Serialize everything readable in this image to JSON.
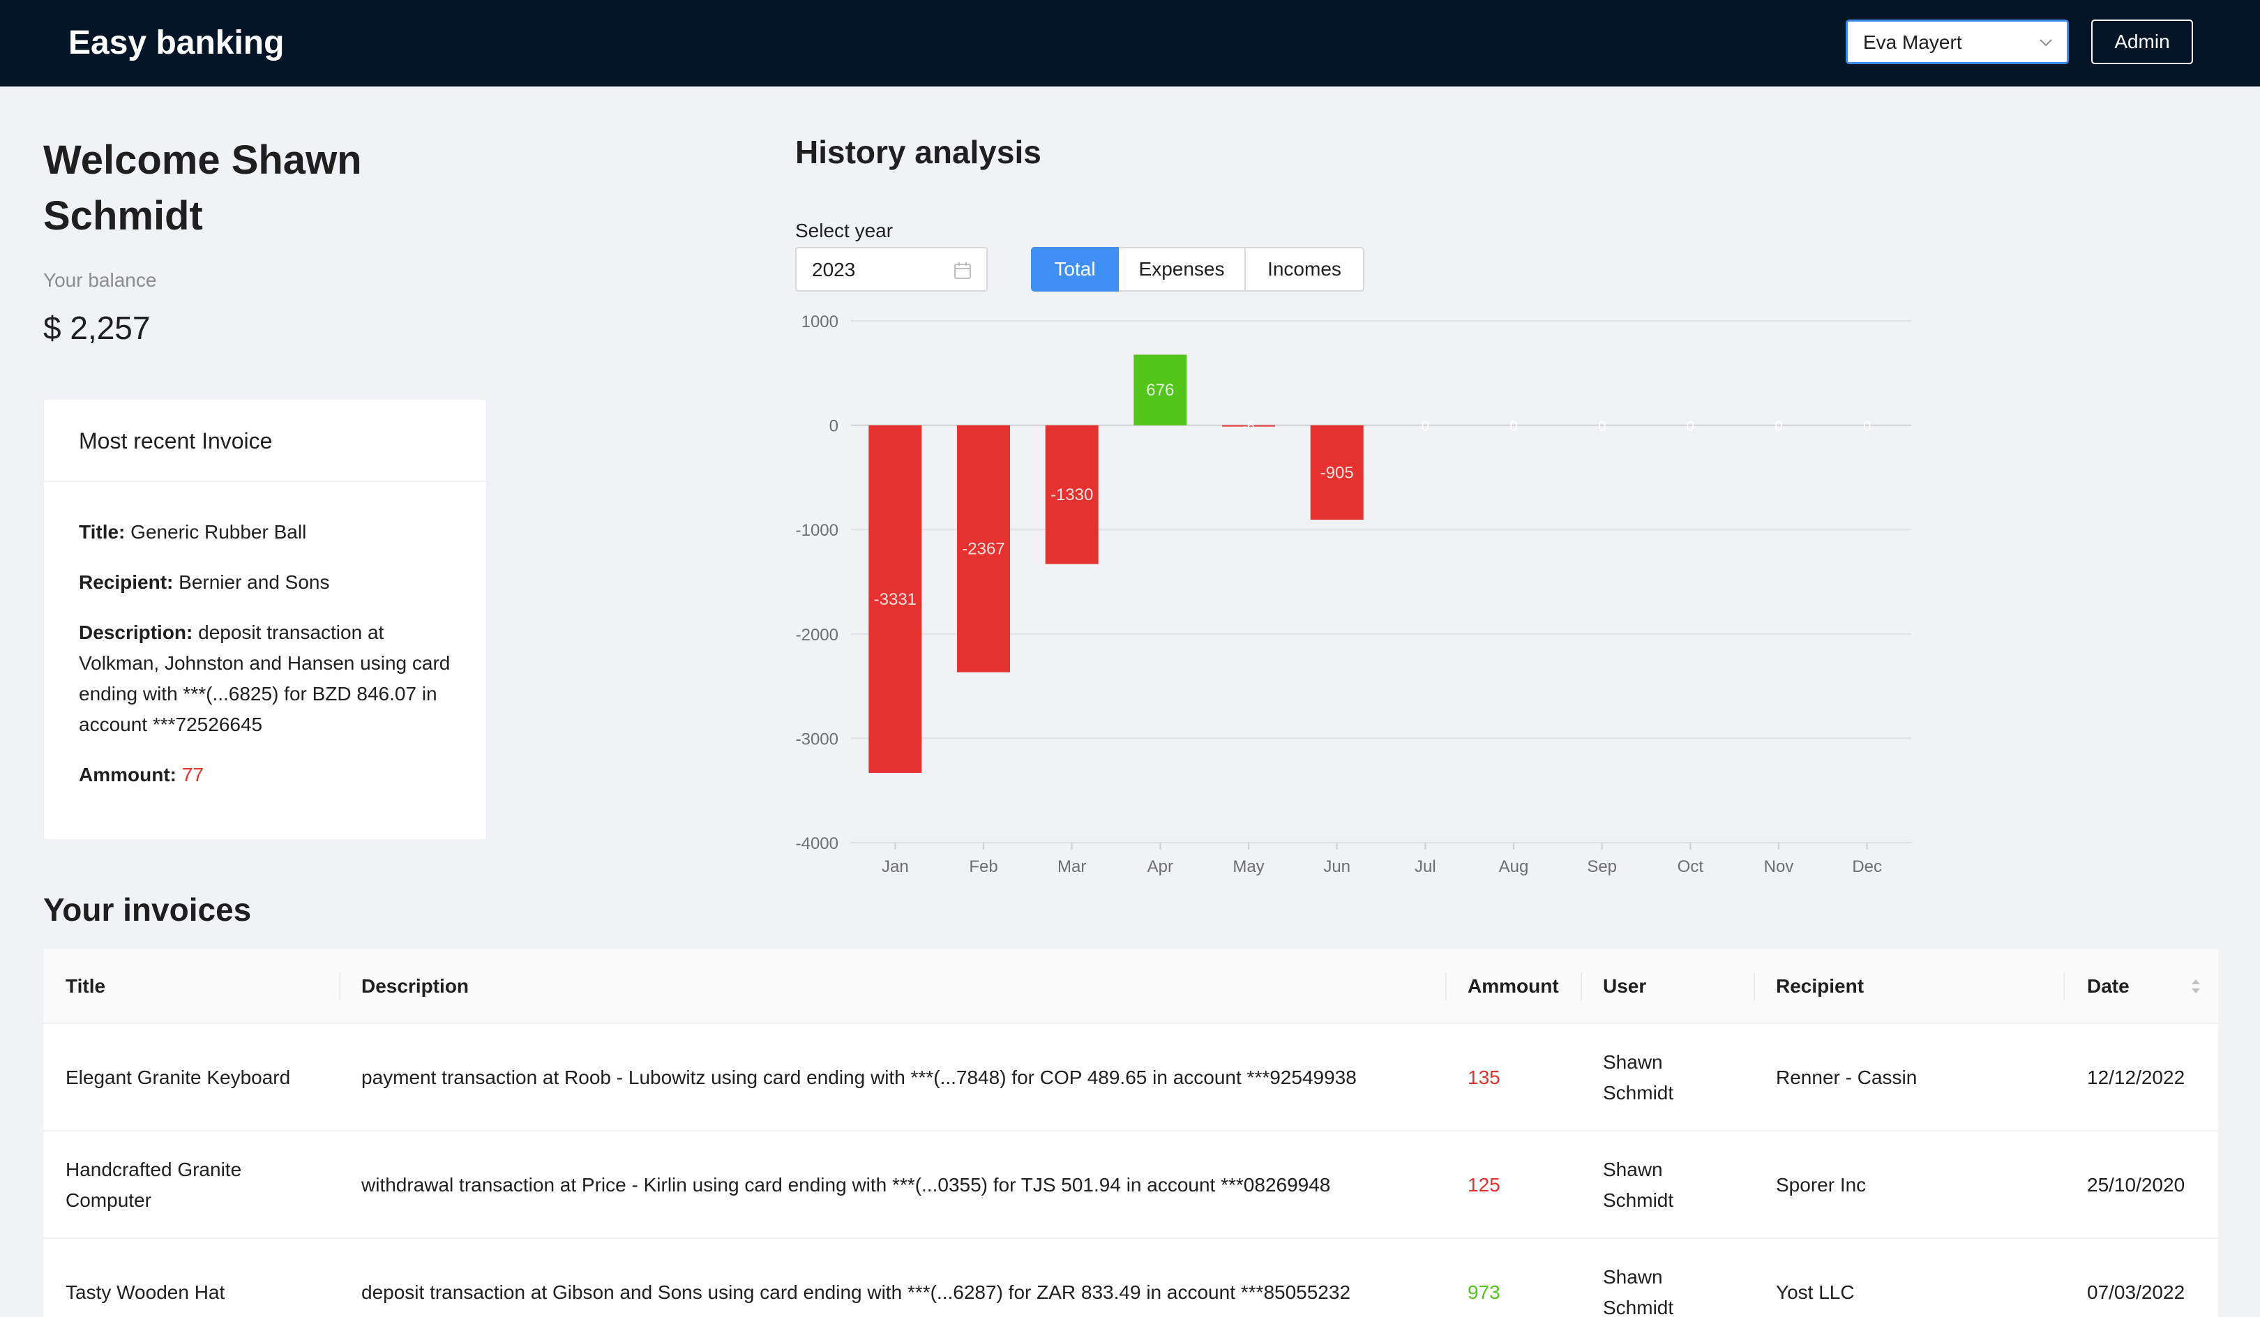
{
  "header": {
    "app_title": "Easy banking",
    "user_select": "Eva Mayert",
    "admin_label": "Admin"
  },
  "welcome": {
    "title": "Welcome Shawn Schmidt",
    "balance_label": "Your balance",
    "balance_value": "$ 2,257"
  },
  "recent_invoice": {
    "card_title": "Most recent Invoice",
    "title_label": "Title:",
    "title_value": "Generic Rubber Ball",
    "recipient_label": "Recipient:",
    "recipient_value": "Bernier and Sons",
    "description_label": "Description:",
    "description_value": "deposit transaction at Volkman, Johnston and Hansen using card ending with ***(...6825) for BZD 846.07 in account ***72526645",
    "amount_label": "Ammount:",
    "amount_value": "77",
    "amount_color": "#e5312f"
  },
  "history": {
    "title": "History analysis",
    "select_year_label": "Select year",
    "year_value": "2023",
    "segments": [
      {
        "label": "Total",
        "active": true
      },
      {
        "label": "Expenses",
        "active": false
      },
      {
        "label": "Incomes",
        "active": false
      }
    ]
  },
  "chart_data": {
    "type": "bar",
    "categories": [
      "Jan",
      "Feb",
      "Mar",
      "Apr",
      "May",
      "Jun",
      "Jul",
      "Aug",
      "Sep",
      "Oct",
      "Nov",
      "Dec"
    ],
    "values": [
      -3331,
      -2367,
      -1330,
      676,
      -6,
      -905,
      0,
      0,
      0,
      0,
      0,
      0
    ],
    "ylim": [
      -4000,
      1000
    ],
    "yticks": [
      1000,
      0,
      -1000,
      -2000,
      -3000,
      -4000
    ],
    "grid": true,
    "negative_color": "#e5312f",
    "positive_color": "#52c41a"
  },
  "invoices": {
    "title": "Your invoices",
    "columns": [
      "Title",
      "Description",
      "Ammount",
      "User",
      "Recipient",
      "Date"
    ],
    "rows": [
      {
        "title": "Elegant Granite Keyboard",
        "description": "payment transaction at Roob - Lubowitz using card ending with ***(...7848) for COP 489.65 in account ***92549938",
        "amount": "135",
        "sign": "neg",
        "user": "Shawn Schmidt",
        "recipient": "Renner - Cassin",
        "date": "12/12/2022"
      },
      {
        "title": "Handcrafted Granite Computer",
        "description": "withdrawal transaction at Price - Kirlin using card ending with ***(...0355) for TJS 501.94 in account ***08269948",
        "amount": "125",
        "sign": "neg",
        "user": "Shawn Schmidt",
        "recipient": "Sporer Inc",
        "date": "25/10/2020"
      },
      {
        "title": "Tasty Wooden Hat",
        "description": "deposit transaction at Gibson and Sons using card ending with ***(...6287) for ZAR 833.49 in account ***85055232",
        "amount": "973",
        "sign": "pos",
        "user": "Shawn Schmidt",
        "recipient": "Yost LLC",
        "date": "07/03/2022"
      }
    ]
  }
}
